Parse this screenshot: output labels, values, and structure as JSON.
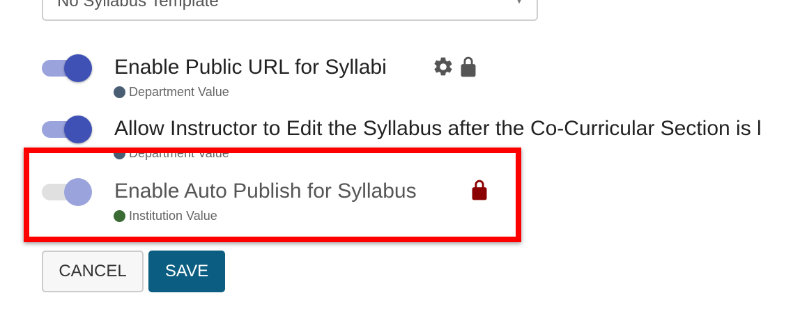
{
  "template_select": {
    "value": "No Syllabus Template"
  },
  "settings": [
    {
      "label": "Enable Public URL for Syllabi",
      "source": "Department Value",
      "source_color": "#4a5e73",
      "enabled": true,
      "icons": [
        "gear-icon",
        "lock-icon"
      ]
    },
    {
      "label": "Allow Instructor to Edit the Syllabus after the Co-Curricular Section is l",
      "source": "Department Value",
      "source_color": "#4a5e73",
      "enabled": true,
      "icons": []
    },
    {
      "label": "Enable Auto Publish for Syllabus",
      "source": "Institution Value",
      "source_color": "#3a6b35",
      "enabled": false,
      "icons": [
        "lock-icon"
      ],
      "lock_color": "#8b0000",
      "highlighted": true
    }
  ],
  "actions": {
    "cancel_label": "CANCEL",
    "save_label": "SAVE"
  },
  "colors": {
    "toggle_on": "#3f51b5",
    "toggle_track_on": "#9aa3dc",
    "save_button": "#0b5e82",
    "highlight": "#ff0000",
    "icon_gray": "#555555"
  }
}
